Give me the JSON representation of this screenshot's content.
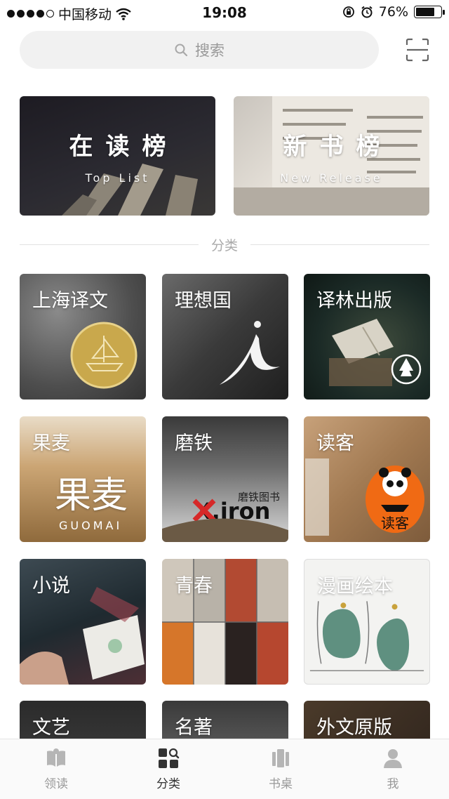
{
  "status_bar": {
    "carrier": "中国移动",
    "time": "19:08",
    "battery": "76%",
    "battery_level": 0.76
  },
  "search": {
    "placeholder": "搜索"
  },
  "rank_lists": [
    {
      "title": "在读榜",
      "subtitle": "Top List"
    },
    {
      "title": "新书榜",
      "subtitle": "New Release"
    }
  ],
  "section": {
    "label": "分类"
  },
  "categories": [
    {
      "label": "上海译文"
    },
    {
      "label": "理想国"
    },
    {
      "label": "译林出版"
    },
    {
      "label": "果麦",
      "art_text": "果麦",
      "art_sub": "GUOMAI"
    },
    {
      "label": "磨铁",
      "art_text": "磨铁图书",
      "art_sub": "X.iron"
    },
    {
      "label": "读客",
      "art_text": "读客"
    },
    {
      "label": "小说"
    },
    {
      "label": "青春"
    },
    {
      "label": "漫画绘本"
    },
    {
      "label": "文艺"
    },
    {
      "label": "名著"
    },
    {
      "label": "外文原版"
    }
  ],
  "tabs": [
    {
      "label": "领读",
      "icon": "book-open-icon",
      "active": false
    },
    {
      "label": "分类",
      "icon": "grid-search-icon",
      "active": true
    },
    {
      "label": "书桌",
      "icon": "bookshelf-icon",
      "active": false
    },
    {
      "label": "我",
      "icon": "person-icon",
      "active": false
    }
  ],
  "colors": {
    "accent_active": "#333333",
    "inactive": "#999999"
  }
}
